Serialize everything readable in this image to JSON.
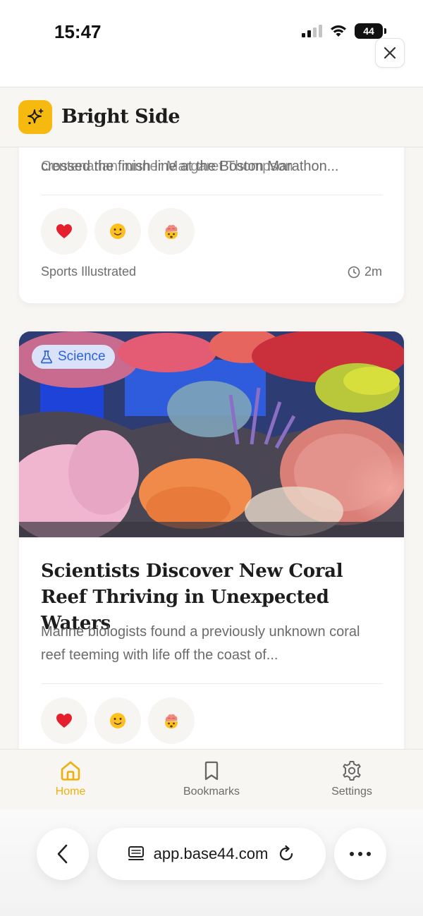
{
  "status_bar": {
    "time": "15:47",
    "battery": "44"
  },
  "app": {
    "name": "Bright Side"
  },
  "cards": [
    {
      "excerpt_partial": "Centenarian runner Margaret Thompson",
      "excerpt": "crossed the finish line at the Boston Marathon...",
      "reactions": [
        "❤️",
        "😊",
        "🤯"
      ],
      "source": "Sports Illustrated",
      "time": "2m"
    },
    {
      "category": "Science",
      "title": "Scientists Discover New Coral Reef Thriving in Unexpected Waters",
      "excerpt": "Marine biologists found a previously unknown coral reef teeming with life off the coast of...",
      "reactions": [
        "❤️",
        "😊",
        "🤯"
      ]
    }
  ],
  "nav": {
    "items": [
      {
        "label": "Home",
        "icon": "home-icon",
        "active": true
      },
      {
        "label": "Bookmarks",
        "icon": "bookmark-icon",
        "active": false
      },
      {
        "label": "Settings",
        "icon": "gear-icon",
        "active": false
      }
    ]
  },
  "browser": {
    "url": "app.base44.com"
  },
  "colors": {
    "accent": "#f5b90f",
    "badge_text": "#2c63d6",
    "badge_bg": "#dbe9ff"
  }
}
